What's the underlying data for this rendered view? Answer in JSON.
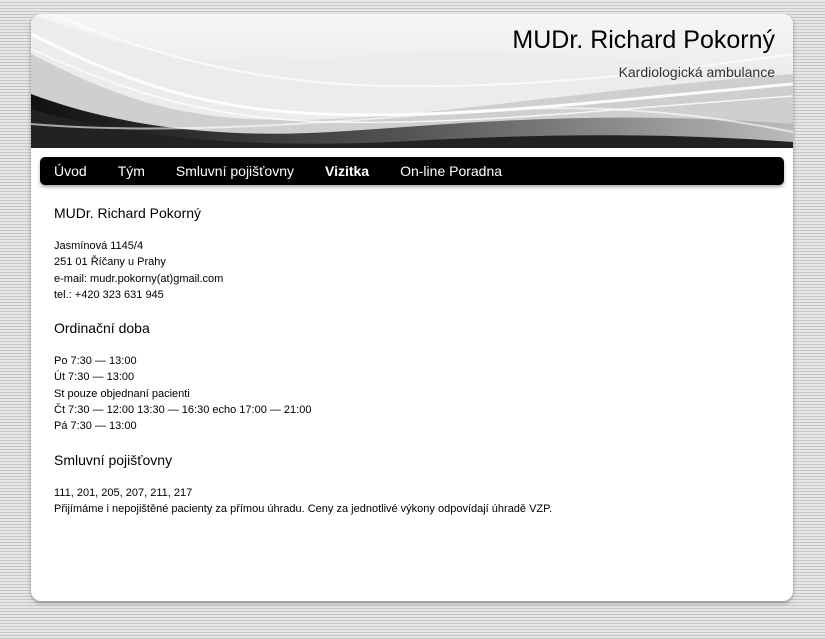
{
  "header": {
    "title": "MUDr. Richard Pokorný",
    "subtitle": "Kardiologická ambulance"
  },
  "nav": {
    "items": [
      {
        "label": "Úvod",
        "active": false
      },
      {
        "label": "Tým",
        "active": false
      },
      {
        "label": "Smluvní pojišťovny",
        "active": false
      },
      {
        "label": "Vizitka",
        "active": true
      },
      {
        "label": "On-line Poradna",
        "active": false
      }
    ]
  },
  "contact": {
    "heading": "MUDr. Richard Pokorný",
    "street": "Jasmínová 1145/4",
    "city": "251 01 Říčany u Prahy",
    "email": "e-mail: mudr.pokorny(at)gmail.com",
    "phone": "tel.: +420 323 631 945"
  },
  "hours": {
    "heading": "Ordinační doba",
    "lines": [
      "Po 7:30 — 13:00",
      "Út 7:30 — 13:00",
      "St pouze objednaní pacienti",
      "Čt 7:30 — 12:00 13:30 — 16:30 echo 17:00 — 21:00",
      "Pá 7:30 — 13:00"
    ]
  },
  "insurance": {
    "heading": "Smluvní pojišťovny",
    "codes": "111, 201, 205, 207, 211, 217",
    "note": "Přijímáme i nepojištěné pacienty za přímou úhradu. Ceny za jednotlivé výkony odpovídají úhradě VZP."
  }
}
